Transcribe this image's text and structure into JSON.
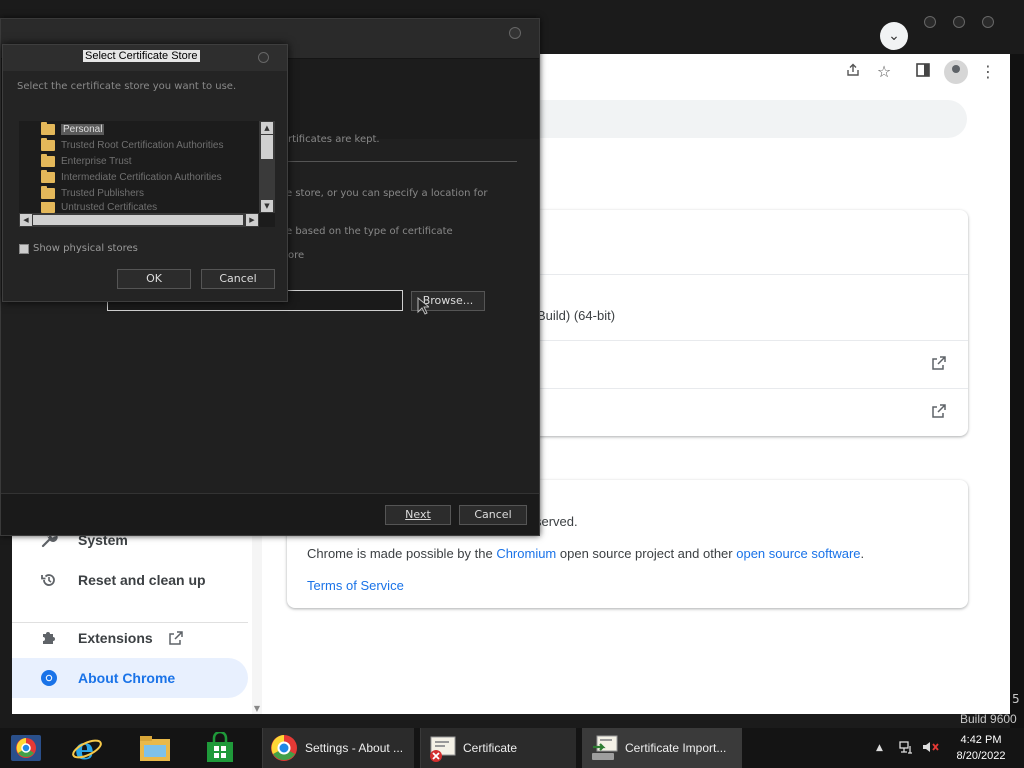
{
  "chrome": {
    "tab_search_glyph": "⌄",
    "toolbar_icons": [
      "share-icon",
      "star-icon",
      "sidebar-icon",
      "profile-icon",
      "menu-icon"
    ],
    "build_text": "Build 9600",
    "build_five": "5",
    "sidebar": {
      "items": [
        {
          "label": "System",
          "icon": "wrench-icon"
        },
        {
          "label": "Reset and clean up",
          "icon": "restore-icon"
        },
        {
          "label": "Extensions",
          "icon": "puzzle-icon"
        },
        {
          "label": "About Chrome",
          "icon": "chrome-icon"
        }
      ]
    },
    "about_card": {
      "version_fragment": "Build) (64-bit)"
    },
    "legal_card": {
      "copyright_fragment": "served.",
      "made_prefix": "Chrome is made possible by the ",
      "chromium_link": "Chromium",
      "made_middle": " open source project and other ",
      "oss_link": "open source software",
      "made_suffix": ".",
      "tos_link": "Terms of Service"
    }
  },
  "wizard": {
    "hint_store_kept": "rtificates are kept.",
    "hint_specify": "e store, or you can specify a location for",
    "hint_auto": "e based on the type of certificate",
    "hint_store": "ore",
    "browse_label": "Browse...",
    "next_label": "Next",
    "cancel_label": "Cancel"
  },
  "store_dialog": {
    "title": "Select Certificate Store",
    "prompt": "Select the certificate store you want to use.",
    "stores": [
      "Personal",
      "Trusted Root Certification Authorities",
      "Enterprise Trust",
      "Intermediate Certification Authorities",
      "Trusted Publishers",
      "Untrusted Certificates"
    ],
    "selected_store": "Personal",
    "show_physical_label": "Show physical stores",
    "show_physical_checked": false,
    "ok_label": "OK",
    "cancel_label": "Cancel"
  },
  "taskbar": {
    "pinned": [
      "chrome-desktop-icon",
      "ie-icon",
      "file-explorer-icon",
      "store-icon"
    ],
    "tasks": [
      {
        "label": "Settings - About ...",
        "icon": "chrome-icon"
      },
      {
        "label": "Certificate",
        "icon": "certificate-error-icon"
      },
      {
        "label": "Certificate Import...",
        "icon": "certificate-import-icon"
      }
    ],
    "time": "4:42 PM",
    "date": "8/20/2022"
  }
}
